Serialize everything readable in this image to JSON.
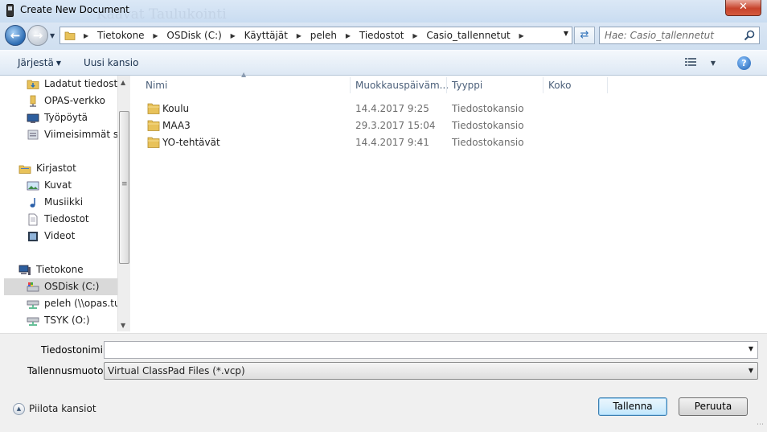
{
  "window": {
    "title": "Create New Document",
    "close_label": "✕",
    "background_text": "Kaavat Taulukointi"
  },
  "address": {
    "breadcrumbs": [
      "Tietokone",
      "OSDisk (C:)",
      "Käyttäjät",
      "peleh",
      "Tiedostot",
      "Casio_tallennetut"
    ],
    "search_placeholder": "Hae: Casio_tallennetut"
  },
  "toolbar": {
    "organize_label": "Järjestä",
    "new_folder_label": "Uusi kansio"
  },
  "nav": {
    "items": [
      {
        "label": "Ladatut tiedostot",
        "icon": "downloads-folder-icon"
      },
      {
        "label": "OPAS-verkko",
        "icon": "network-folder-icon"
      },
      {
        "label": "Työpöytä",
        "icon": "desktop-icon"
      },
      {
        "label": "Viimeisimmät sijainnit",
        "icon": "recent-places-icon"
      },
      {
        "label": "Kirjastot",
        "icon": "libraries-icon"
      },
      {
        "label": "Kuvat",
        "icon": "pictures-icon"
      },
      {
        "label": "Musiikki",
        "icon": "music-icon"
      },
      {
        "label": "Tiedostot",
        "icon": "documents-icon"
      },
      {
        "label": "Videot",
        "icon": "videos-icon"
      },
      {
        "label": "Tietokone",
        "icon": "computer-icon"
      },
      {
        "label": "OSDisk (C:)",
        "icon": "drive-icon"
      },
      {
        "label": "peleh (\\\\opas.tur",
        "icon": "network-drive-icon"
      },
      {
        "label": "TSYK (O:)",
        "icon": "network-drive-icon"
      }
    ],
    "selected": "OSDisk (C:)"
  },
  "files": {
    "columns": [
      "Nimi",
      "Muokkauspäiväm...",
      "Tyyppi",
      "Koko"
    ],
    "rows": [
      {
        "name": "Koulu",
        "modified": "14.4.2017 9:25",
        "type": "Tiedostokansio",
        "size": ""
      },
      {
        "name": "MAA3",
        "modified": "29.3.2017 15:04",
        "type": "Tiedostokansio",
        "size": ""
      },
      {
        "name": "YO-tehtävät",
        "modified": "14.4.2017 9:41",
        "type": "Tiedostokansio",
        "size": ""
      }
    ]
  },
  "form": {
    "filename_label": "Tiedostonimi:",
    "filename_value": "",
    "type_label": "Tallennusmuoto:",
    "type_value": "Virtual ClassPad Files (*.vcp)",
    "hide_folders_label": "Piilota kansiot",
    "save_label": "Tallenna",
    "cancel_label": "Peruuta"
  },
  "colors": {
    "window_frame": "#cfdff0",
    "close_button": "#c7432b",
    "folder": "#e8c25a"
  }
}
